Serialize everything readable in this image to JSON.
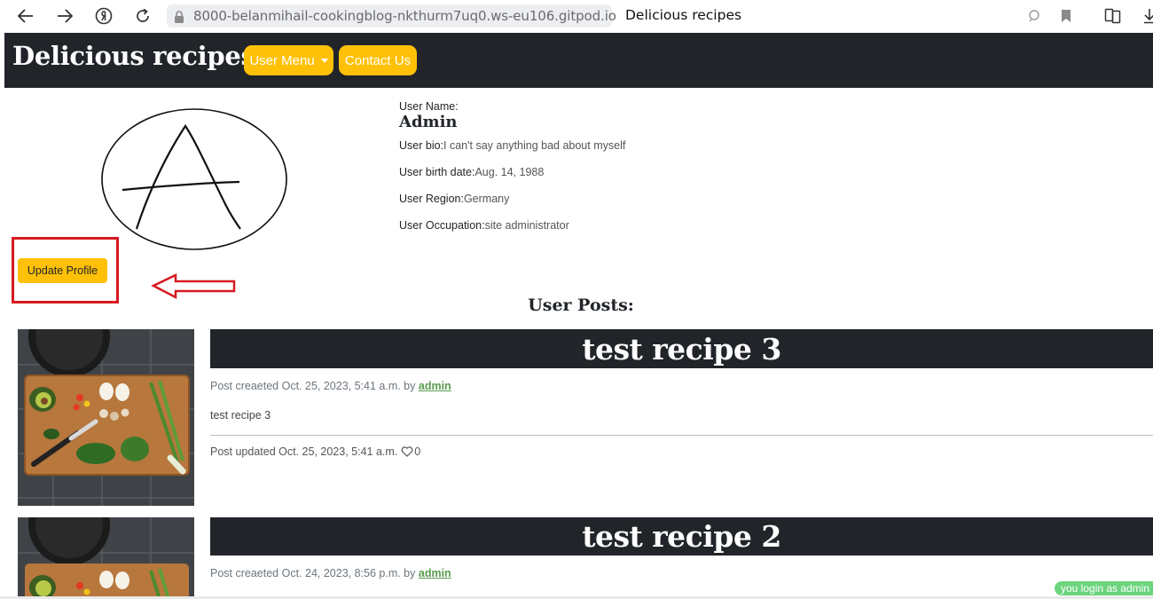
{
  "browser": {
    "url": "8000-belanmihail-cookingblog-nkthurm7uq0.ws-eu106.gitpod.io",
    "tab_title": "Delicious recipes",
    "icons": [
      "back-icon",
      "forward-icon",
      "yandex-icon",
      "reload-icon",
      "lock-icon",
      "search-icon",
      "bookmark-icon",
      "collections-icon",
      "download-icon"
    ]
  },
  "navbar": {
    "brand": "Delicious recipes",
    "user_menu": "User Menu",
    "contact": "Contact Us",
    "accent_color": "#ffc107",
    "bg_color": "#212529"
  },
  "profile": {
    "username_label": "User Name:",
    "username": "Admin",
    "bio_label": "User bio:",
    "bio": "I can't say anything bad about myself",
    "birth_label": "User birth date:",
    "birth": "Aug. 14, 1988",
    "region_label": "User Region:",
    "region": "Germany",
    "occupation_label": "User Occupation:",
    "occupation": "site administrator",
    "update_button": "Update Profile"
  },
  "posts_heading": "User Posts:",
  "posts": [
    {
      "title": "test recipe 3",
      "created_prefix": "Post creaeted Oct. 25, 2023, 5:41 a.m. by",
      "author": "admin",
      "excerpt": "test recipe 3",
      "updated": "Post updated Oct. 25, 2023, 5:41 a.m.",
      "likes": "0"
    },
    {
      "title": "test recipe 2",
      "created_prefix": "Post creaeted Oct. 24, 2023, 8:56 p.m. by",
      "author": "admin"
    }
  ],
  "login_badge": "you login as admin"
}
